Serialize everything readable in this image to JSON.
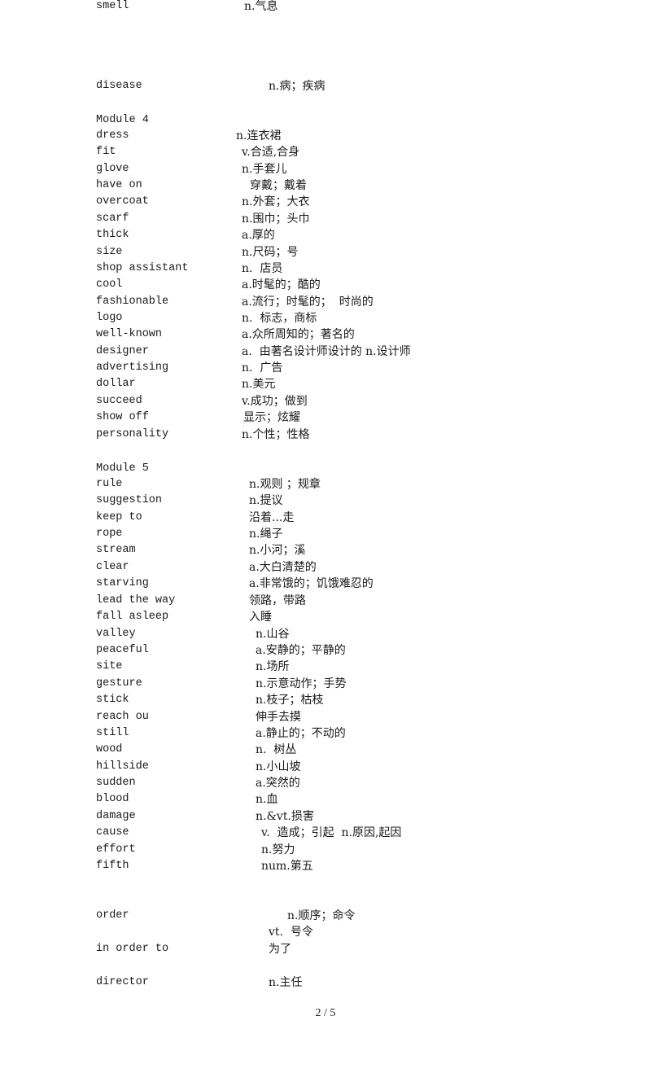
{
  "page": {
    "number_label": "2 / 5"
  },
  "entries": [
    {
      "kind": "entry",
      "term": "disease",
      "def": "n.病；疾病"
    },
    {
      "kind": "heading",
      "text": "Module 4"
    },
    {
      "kind": "entry",
      "term": "dress",
      "def": "n.连衣裙"
    },
    {
      "kind": "entry",
      "term": "fit",
      "def": "v.合适,合身"
    },
    {
      "kind": "entry",
      "term": "glove",
      "def": "n.手套儿"
    },
    {
      "kind": "entry",
      "term": "have on",
      "def": "穿戴；戴着"
    },
    {
      "kind": "entry",
      "term": "overcoat",
      "def": "n.外套；大衣"
    },
    {
      "kind": "entry",
      "term": "scarf",
      "def": "n.围巾；头巾"
    },
    {
      "kind": "entry",
      "term": "thick",
      "def": "a.厚的"
    },
    {
      "kind": "entry",
      "term": "size",
      "def": "n.尺码；号"
    },
    {
      "kind": "entry",
      "term": "shop assistant",
      "def": "n.  店员"
    },
    {
      "kind": "entry",
      "term": "cool",
      "def": "a.时髦的；酷的"
    },
    {
      "kind": "entry",
      "term": "fashionable",
      "def": "a.流行；时髦的；  时尚的"
    },
    {
      "kind": "entry",
      "term": "logo",
      "def": "n.  标志，商标"
    },
    {
      "kind": "entry",
      "term": "well-known",
      "def": "a.众所周知的；著名的"
    },
    {
      "kind": "entry",
      "term": "designer",
      "def": "a.  由著名设计师设计的 n.设计师"
    },
    {
      "kind": "entry",
      "term": "advertising",
      "def": "n.  广告"
    },
    {
      "kind": "entry",
      "term": "dollar",
      "def": "n.美元"
    },
    {
      "kind": "entry",
      "term": "succeed",
      "def": "v.成功；做到"
    },
    {
      "kind": "entry",
      "term": "show off",
      "def": "显示；炫耀"
    },
    {
      "kind": "entry",
      "term": "personality",
      "def": "n.个性；性格"
    },
    {
      "kind": "heading",
      "text": "Module 5"
    },
    {
      "kind": "entry",
      "term": "rule",
      "def": "n.观则 ；规章"
    },
    {
      "kind": "entry",
      "term": "suggestion",
      "def": "n.提议"
    },
    {
      "kind": "entry",
      "term": "keep to",
      "def": "沿着...走"
    },
    {
      "kind": "entry",
      "term": "rope",
      "def": "n.绳子"
    },
    {
      "kind": "entry",
      "term": "stream",
      "def": "n.小河；溪"
    },
    {
      "kind": "entry",
      "term": "clear",
      "def": "a.大白清楚的"
    },
    {
      "kind": "entry",
      "term": "starving",
      "def": "a.非常饿的；饥饿难忍的"
    },
    {
      "kind": "entry",
      "term": "lead the way",
      "def": "领路，带路"
    },
    {
      "kind": "entry",
      "term": "fall asleep",
      "def": "入睡"
    },
    {
      "kind": "entry",
      "term": "valley",
      "def": "n.山谷"
    },
    {
      "kind": "entry",
      "term": "peaceful",
      "def": "a.安静的；平静的"
    },
    {
      "kind": "entry",
      "term": "site",
      "def": "n.场所"
    },
    {
      "kind": "entry",
      "term": "gesture",
      "def": "n.示意动作；手势"
    },
    {
      "kind": "entry",
      "term": "stick",
      "def": "n.枝子；枯枝"
    },
    {
      "kind": "entry",
      "term": "reach ou",
      "def": "伸手去摸"
    },
    {
      "kind": "entry",
      "term": "still",
      "def": "a.静止的；不动的"
    },
    {
      "kind": "entry",
      "term": "wood",
      "def": "n.  树丛"
    },
    {
      "kind": "entry",
      "term": "hillside",
      "def": "n.小山坡"
    },
    {
      "kind": "entry",
      "term": "sudden",
      "def": "a.突然的"
    },
    {
      "kind": "entry",
      "term": "blood",
      "def": "n.血"
    },
    {
      "kind": "entry",
      "term": "damage",
      "def": "n.&vt.损害"
    },
    {
      "kind": "entry",
      "term": "cause",
      "def": "v.  造成；引起  n.原因,起因"
    },
    {
      "kind": "entry",
      "term": "effort",
      "def": "n.努力"
    },
    {
      "kind": "entry",
      "term": "fifth",
      "def": "num.第五"
    },
    {
      "kind": "entry",
      "term": "order",
      "def": "n.顺序；命令"
    },
    {
      "kind": "continuation",
      "def": "vt.  号令"
    },
    {
      "kind": "entry",
      "term": "in order to",
      "def": "为了"
    },
    {
      "kind": "entry",
      "term": "director",
      "def": "n.主任"
    },
    {
      "kind": "entry",
      "term": "smell",
      "def": "n.气息"
    }
  ]
}
